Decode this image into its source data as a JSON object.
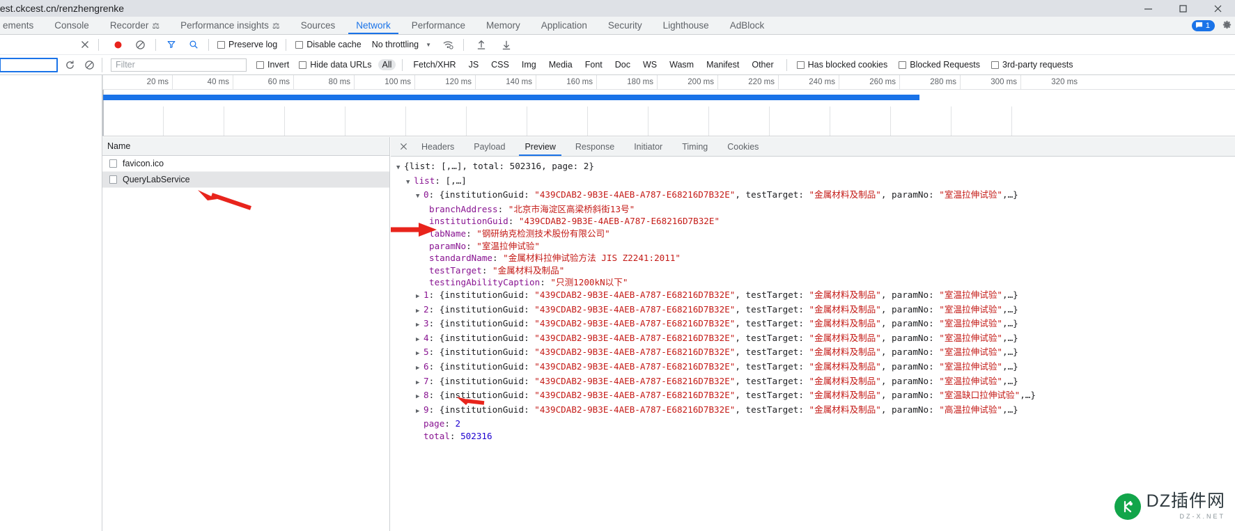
{
  "browser": {
    "url": "test.ckcest.cn/renzhengrenke",
    "window_buttons": [
      "minimize",
      "maximize",
      "close"
    ]
  },
  "devtools": {
    "tabs": [
      {
        "label": "ements",
        "selected": false,
        "warn": false
      },
      {
        "label": "Console",
        "selected": false,
        "warn": false
      },
      {
        "label": "Recorder",
        "selected": false,
        "warn": true
      },
      {
        "label": "Performance insights",
        "selected": false,
        "warn": true
      },
      {
        "label": "Sources",
        "selected": false,
        "warn": false
      },
      {
        "label": "Network",
        "selected": true,
        "warn": false
      },
      {
        "label": "Performance",
        "selected": false,
        "warn": false
      },
      {
        "label": "Memory",
        "selected": false,
        "warn": false
      },
      {
        "label": "Application",
        "selected": false,
        "warn": false
      },
      {
        "label": "Security",
        "selected": false,
        "warn": false
      },
      {
        "label": "Lighthouse",
        "selected": false,
        "warn": false
      },
      {
        "label": "AdBlock",
        "selected": false,
        "warn": false
      }
    ],
    "message_count": "1",
    "settings_icon": "gear-icon",
    "accent_color": "#1a73e8"
  },
  "network_toolbar": {
    "record_title": "record-button",
    "clear_title": "clear-button",
    "filter_title": "filter-button",
    "search_title": "search-button",
    "preserve_log": "Preserve log",
    "disable_cache": "Disable cache",
    "throttling": "No throttling",
    "wifi_icon": "wifi-throttle-icon",
    "import_icon": "import-har-icon",
    "export_icon": "export-har-icon",
    "close_icon": "close-icon"
  },
  "filter_bar": {
    "filter_placeholder": "Filter",
    "invert": "Invert",
    "hide_data_urls": "Hide data URLs",
    "types": [
      "All",
      "Fetch/XHR",
      "JS",
      "CSS",
      "Img",
      "Media",
      "Font",
      "Doc",
      "WS",
      "Wasm",
      "Manifest",
      "Other"
    ],
    "active_type": "All",
    "has_blocked_cookies": "Has blocked cookies",
    "blocked_requests": "Blocked Requests",
    "third_party_requests": "3rd-party requests",
    "reload_icon": "reload-icon",
    "no_icon": "clear-icon"
  },
  "overview": {
    "ticks": [
      "20 ms",
      "40 ms",
      "60 ms",
      "80 ms",
      "100 ms",
      "120 ms",
      "140 ms",
      "160 ms",
      "180 ms",
      "200 ms",
      "220 ms",
      "240 ms",
      "260 ms",
      "280 ms",
      "300 ms",
      "320 ms"
    ],
    "bar_color": "#1a73e8",
    "bar_end_pct": 72
  },
  "request_list": {
    "column_header": "Name",
    "rows": [
      {
        "name": "favicon.ico",
        "selected": false
      },
      {
        "name": "QueryLabService",
        "selected": true
      }
    ]
  },
  "detail": {
    "tabs": [
      "Headers",
      "Payload",
      "Preview",
      "Response",
      "Initiator",
      "Timing",
      "Cookies"
    ],
    "selected_tab": "Preview",
    "close_label": "×"
  },
  "preview": {
    "root": {
      "twisty": "▼",
      "text": "{list: [,…], total: 502316, page: 2}"
    },
    "list_line": {
      "twisty": "▼",
      "key": "list",
      "value": "[,…]"
    },
    "item0_header": {
      "twisty": "▼",
      "index": "0",
      "prefix": "{institutionGuid: ",
      "guid": "\"439CDAB2-9B3E-4AEB-A787-E68216D7B32E\"",
      "mid1": ", testTarget: ",
      "testTarget": "\"金属材料及制品\"",
      "mid2": ", paramNo: ",
      "paramNo": "\"室温拉伸试验\"",
      "suffix": ",…}"
    },
    "item0_props": [
      {
        "key": "branchAddress",
        "value": "\"北京市海淀区高梁桥斜街13号\""
      },
      {
        "key": "institutionGuid",
        "value": "\"439CDAB2-9B3E-4AEB-A787-E68216D7B32E\""
      },
      {
        "key": "labName",
        "value": "\"钢研纳克检测技术股份有限公司\""
      },
      {
        "key": "paramNo",
        "value": "\"室温拉伸试验\""
      },
      {
        "key": "standardName",
        "value": "\"金属材料拉伸试验方法 JIS Z2241:2011\""
      },
      {
        "key": "testTarget",
        "value": "\"金属材料及制品\""
      },
      {
        "key": "testingAbilityCaption",
        "value": "\"只测1200kN以下\""
      }
    ],
    "collapsed_items": [
      {
        "index": "1",
        "guid": "\"439CDAB2-9B3E-4AEB-A787-E68216D7B32E\"",
        "testTarget": "\"金属材料及制品\"",
        "paramNo": "\"室温拉伸试验\""
      },
      {
        "index": "2",
        "guid": "\"439CDAB2-9B3E-4AEB-A787-E68216D7B32E\"",
        "testTarget": "\"金属材料及制品\"",
        "paramNo": "\"室温拉伸试验\""
      },
      {
        "index": "3",
        "guid": "\"439CDAB2-9B3E-4AEB-A787-E68216D7B32E\"",
        "testTarget": "\"金属材料及制品\"",
        "paramNo": "\"室温拉伸试验\""
      },
      {
        "index": "4",
        "guid": "\"439CDAB2-9B3E-4AEB-A787-E68216D7B32E\"",
        "testTarget": "\"金属材料及制品\"",
        "paramNo": "\"室温拉伸试验\""
      },
      {
        "index": "5",
        "guid": "\"439CDAB2-9B3E-4AEB-A787-E68216D7B32E\"",
        "testTarget": "\"金属材料及制品\"",
        "paramNo": "\"室温拉伸试验\""
      },
      {
        "index": "6",
        "guid": "\"439CDAB2-9B3E-4AEB-A787-E68216D7B32E\"",
        "testTarget": "\"金属材料及制品\"",
        "paramNo": "\"室温拉伸试验\""
      },
      {
        "index": "7",
        "guid": "\"439CDAB2-9B3E-4AEB-A787-E68216D7B32E\"",
        "testTarget": "\"金属材料及制品\"",
        "paramNo": "\"室温拉伸试验\""
      },
      {
        "index": "8",
        "guid": "\"439CDAB2-9B3E-4AEB-A787-E68216D7B32E\"",
        "testTarget": "\"金属材料及制品\"",
        "paramNo": "\"室温缺口拉伸试验\""
      },
      {
        "index": "9",
        "guid": "\"439CDAB2-9B3E-4AEB-A787-E68216D7B32E\"",
        "testTarget": "\"金属材料及制品\"",
        "paramNo": "\"高温拉伸试验\""
      }
    ],
    "page_line": {
      "key": "page",
      "value": "2"
    },
    "total_line": {
      "key": "total",
      "value": "502316"
    }
  },
  "annotations": {
    "arrow_color": "#e8241c",
    "arrow_list_item": "arrow-pointing-to-querylabservice",
    "arrow_labname": "arrow-pointing-to-labname",
    "arrow_page": "arrow-pointing-to-page-value"
  },
  "watermark": {
    "main": "DZ插件网",
    "sub": "DZ-X.NET",
    "logo_color": "#12a54a"
  }
}
